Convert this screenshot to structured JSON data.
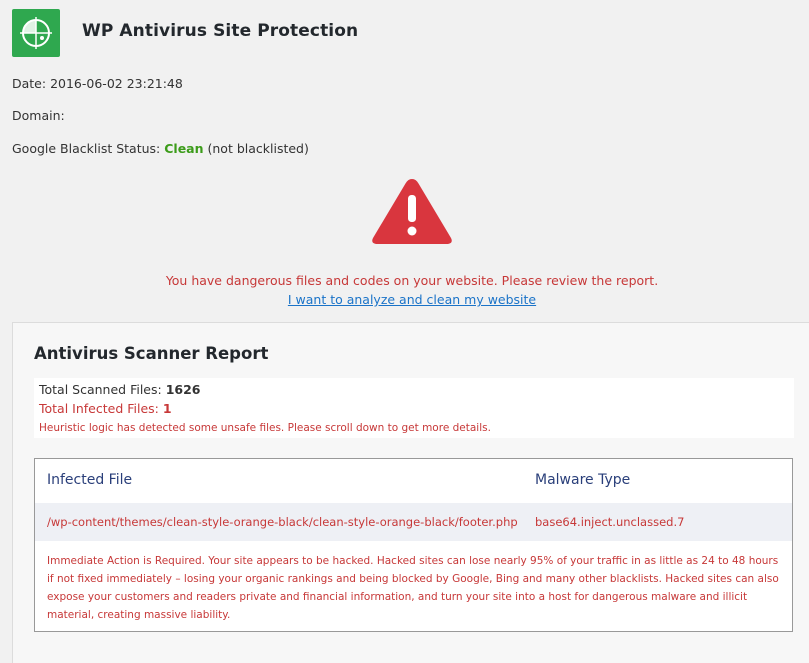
{
  "app": {
    "title": "WP Antivirus Site Protection",
    "logo_icon": "radar-crosshair-icon"
  },
  "meta": {
    "date_label": "Date:",
    "date_value": "2016-06-02 23:21:48",
    "domain_label": "Domain:",
    "domain_value": "",
    "google_label": "Google Blacklist Status:",
    "google_status": "Clean",
    "google_note": "(not blacklisted)"
  },
  "alert": {
    "icon": "warning-triangle-icon",
    "message": "You have dangerous files and codes on your website. Please review the report.",
    "link_text": "I want to analyze and clean my website"
  },
  "report": {
    "title": "Antivirus Scanner Report",
    "total_scanned_label": "Total Scanned Files:",
    "total_scanned_value": "1626",
    "total_infected_label": "Total Infected Files:",
    "total_infected_value": "1",
    "heuristic_note": "Heuristic logic has detected some unsafe files. Please scroll down to get more details.",
    "table": {
      "headers": [
        "Infected File",
        "Malware Type"
      ],
      "rows": [
        [
          "/wp-content/themes/clean-style-orange-black/clean-style-orange-black/footer.php",
          "base64.inject.unclassed.7"
        ]
      ],
      "action_note": "Immediate Action is Required. Your site appears to be hacked. Hacked sites can lose nearly 95% of your traffic in as little as 24 to 48 hours if not fixed immediately – losing your organic rankings and being blocked by Google, Bing and many other blacklists. Hacked sites can also expose your customers and readers private and financial information, and turn your site into a host for dangerous malware and illicit material, creating massive liability."
    }
  },
  "colors": {
    "brand_green": "#2fa84f",
    "danger_red": "#c73838",
    "warning_icon_red": "#d9363e",
    "clean_green": "#3c9c1a",
    "link_blue": "#1a73c8",
    "header_navy": "#2a3f7a"
  }
}
